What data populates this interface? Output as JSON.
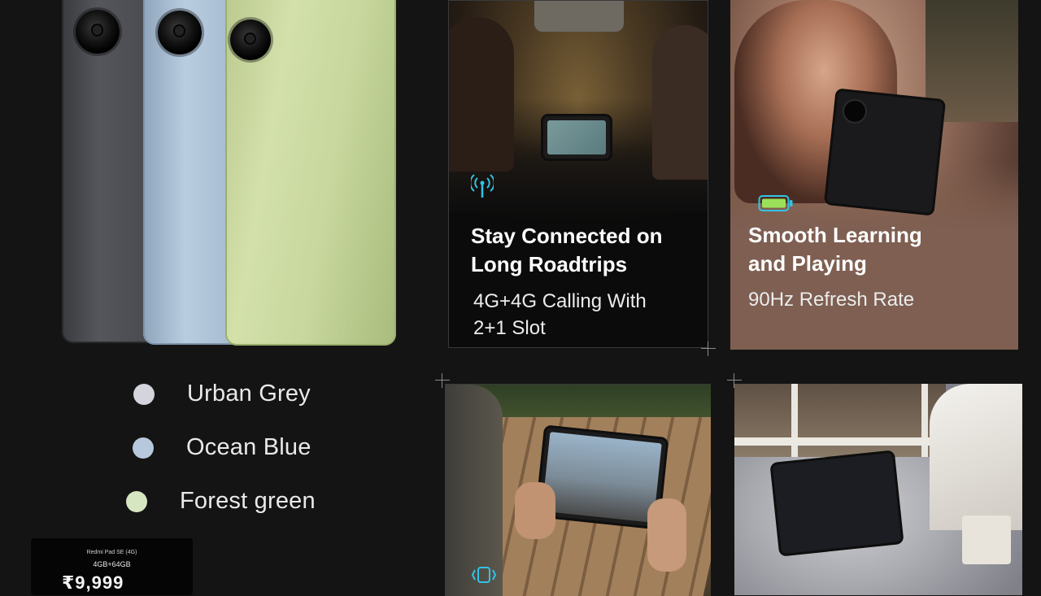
{
  "colors": {
    "background": "#141414",
    "urban_grey": "#d3d4dc",
    "ocean_blue": "#b7c7dc",
    "forest_green": "#d6e6c1",
    "accent_icon": "#33c3e6"
  },
  "color_options": [
    {
      "label": "Urban Grey"
    },
    {
      "label": "Ocean Blue"
    },
    {
      "label": "Forest green"
    }
  ],
  "price_card": {
    "model": "Redmi Pad SE (4G)",
    "variant": "4GB+64GB",
    "price": "₹9,999"
  },
  "features": [
    {
      "title_line1": "Stay Connected on",
      "title_line2": "Long Roadtrips",
      "sub_line1": "4G+4G Calling With",
      "sub_line2": "2+1 Slot",
      "icon": "antenna-icon"
    },
    {
      "title_line1": "Smooth Learning",
      "title_line2": "and Playing",
      "sub_line1": "90Hz Refresh Rate",
      "icon": "battery-icon"
    },
    {
      "icon": "vibration-icon"
    },
    {
      "icon": "tablet-icon"
    }
  ]
}
